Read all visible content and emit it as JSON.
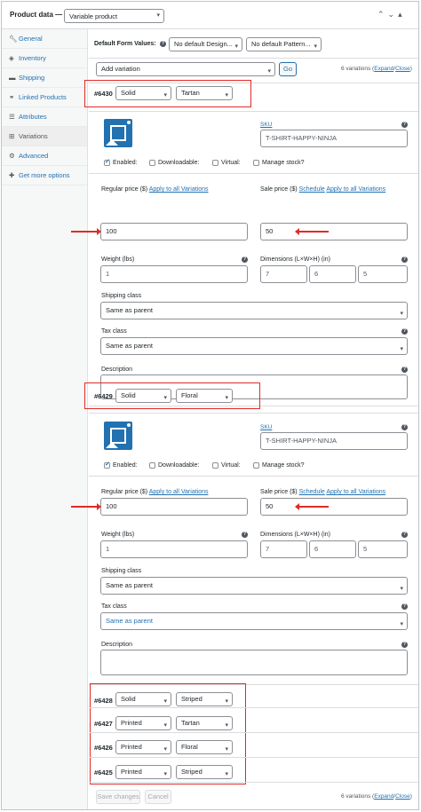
{
  "header": {
    "title": "Product data —",
    "product_type": "Variable product"
  },
  "sidebar": {
    "items": [
      {
        "label": "General",
        "icon": "wrench-icon"
      },
      {
        "label": "Inventory",
        "icon": "tag-icon"
      },
      {
        "label": "Shipping",
        "icon": "truck-icon"
      },
      {
        "label": "Linked Products",
        "icon": "link-icon"
      },
      {
        "label": "Attributes",
        "icon": "list-icon"
      },
      {
        "label": "Variations",
        "icon": "grid-icon"
      },
      {
        "label": "Advanced",
        "icon": "gear-icon"
      },
      {
        "label": "Get more options",
        "icon": "plugin-icon"
      }
    ]
  },
  "defaults": {
    "label": "Default Form Values:",
    "design": "No default Design...",
    "pattern": "No default Pattern..."
  },
  "toolbar": {
    "add_variation": "Add variation",
    "go": "Go",
    "count": "6 variations",
    "expand": "Expand",
    "close": "Close",
    "sep": "/"
  },
  "labels": {
    "sku": "SKU",
    "enabled": "Enabled:",
    "downloadable": "Downloadable:",
    "virtual": "Virtual:",
    "manage_stock": "Manage stock?",
    "regular_price": "Regular price ($)",
    "apply_all": "Apply to all Variations",
    "sale_price": "Sale price ($)",
    "schedule": "Schedule",
    "weight": "Weight (lbs)",
    "dimensions": "Dimensions (L×W×H) (in)",
    "shipping_class": "Shipping class",
    "tax_class": "Tax class",
    "description": "Description"
  },
  "variations": [
    {
      "id": "#6430",
      "design": "Solid",
      "pattern": "Tartan",
      "sku": "T-SHIRT-HAPPY-NINJA",
      "regular_price": "100",
      "sale_price": "50",
      "weight": "1",
      "length": "7",
      "width": "6",
      "height": "5",
      "shipping_class": "Same as parent",
      "tax_class": "Same as parent"
    },
    {
      "id": "#6429",
      "design": "Solid",
      "pattern": "Floral",
      "sku": "T-SHIRT-HAPPY-NINJA",
      "regular_price": "100",
      "sale_price": "50",
      "weight": "1",
      "length": "7",
      "width": "6",
      "height": "5",
      "shipping_class": "Same as parent",
      "tax_class": "Same as parent"
    },
    {
      "id": "#6428",
      "design": "Solid",
      "pattern": "Striped"
    },
    {
      "id": "#6427",
      "design": "Printed",
      "pattern": "Tartan"
    },
    {
      "id": "#6426",
      "design": "Printed",
      "pattern": "Floral"
    },
    {
      "id": "#6425",
      "design": "Printed",
      "pattern": "Striped"
    }
  ],
  "footer": {
    "save": "Save changes",
    "cancel": "Cancel",
    "count": "6 variations",
    "expand": "Expand",
    "close": "Close",
    "sep": "/"
  },
  "colors": {
    "accent": "#2271b1",
    "annotation": "#e02b27"
  }
}
